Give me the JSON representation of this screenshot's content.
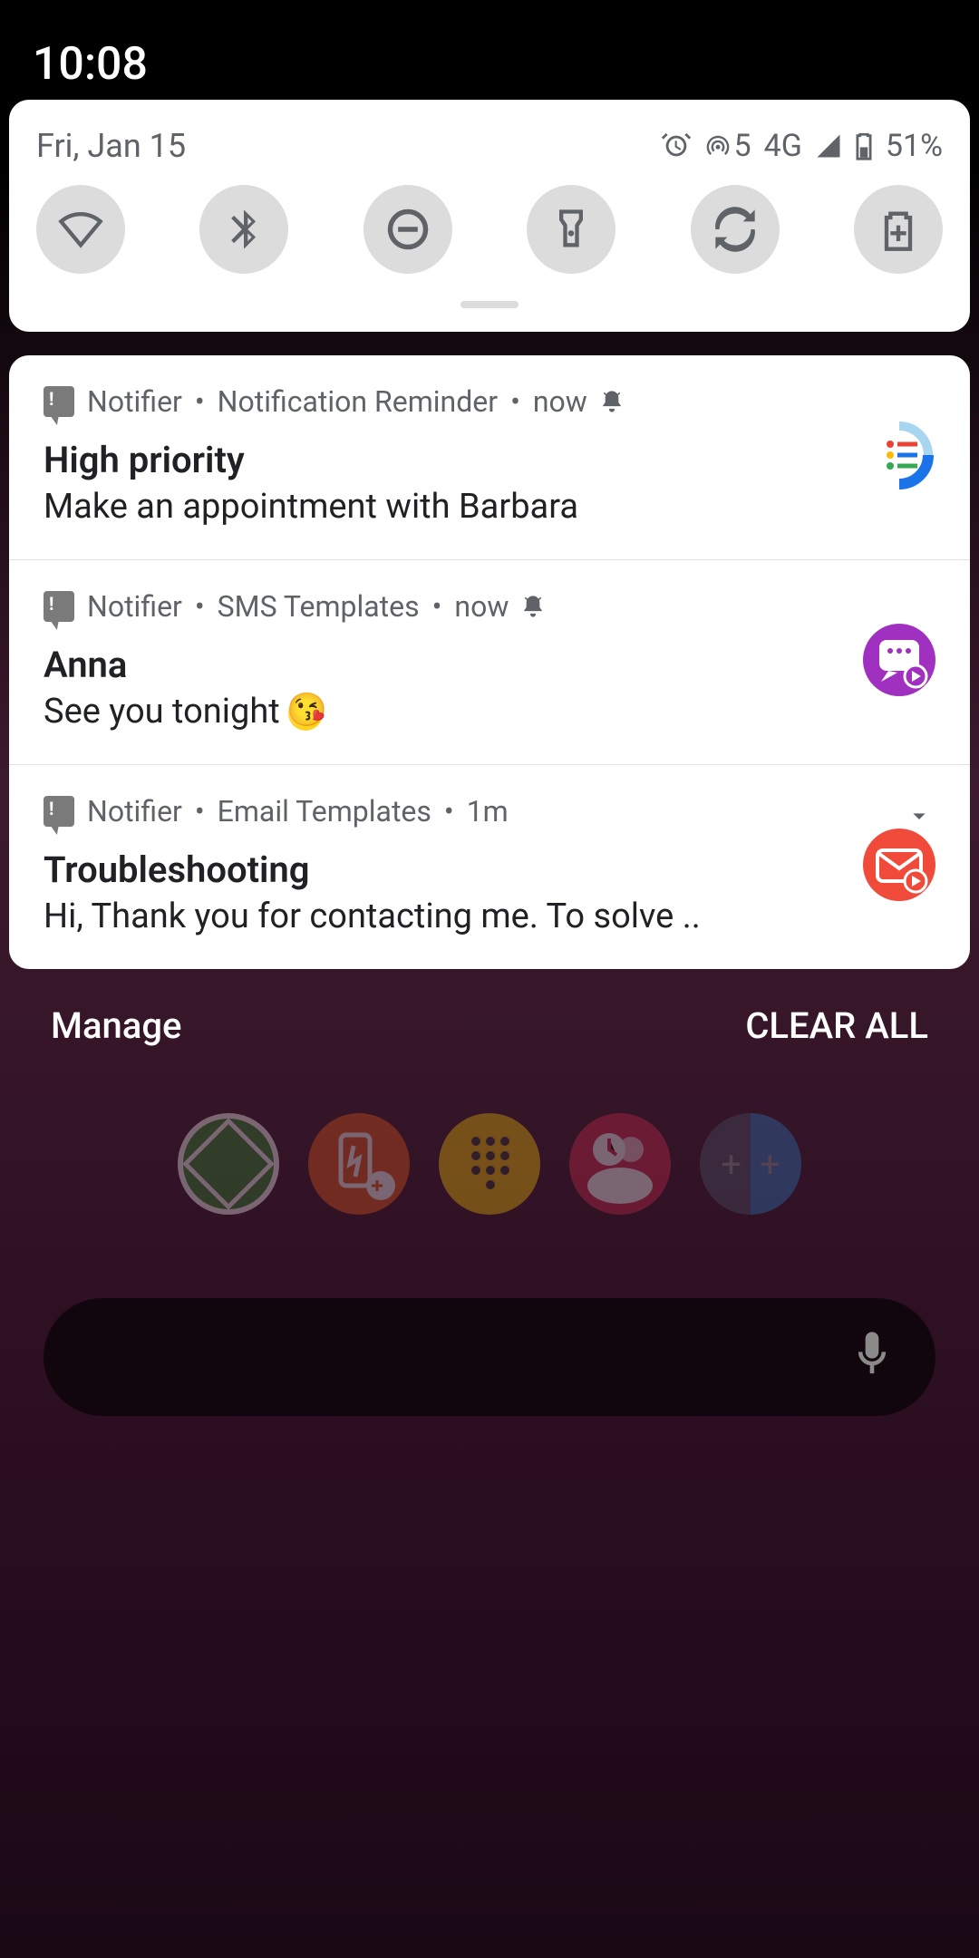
{
  "clock": "10:08",
  "qs": {
    "date": "Fri, Jan 15",
    "hotspot": "5",
    "network": "4G",
    "battery": "51%"
  },
  "notifications": [
    {
      "app": "Notifier",
      "source": "Notification Reminder",
      "time": "now",
      "title": "High priority",
      "body": "Make an appointment with Barbara",
      "hasBell": true
    },
    {
      "app": "Notifier",
      "source": "SMS Templates",
      "time": "now",
      "title": "Anna",
      "body": "See you tonight ",
      "hasBell": true,
      "emoji": true
    },
    {
      "app": "Notifier",
      "source": "Email Templates",
      "time": "1m",
      "title": "Troubleshooting",
      "body": "Hi, Thank you for contacting me. To solve ..",
      "expandable": true
    }
  ],
  "actions": {
    "manage": "Manage",
    "clear": "CLEAR ALL"
  }
}
